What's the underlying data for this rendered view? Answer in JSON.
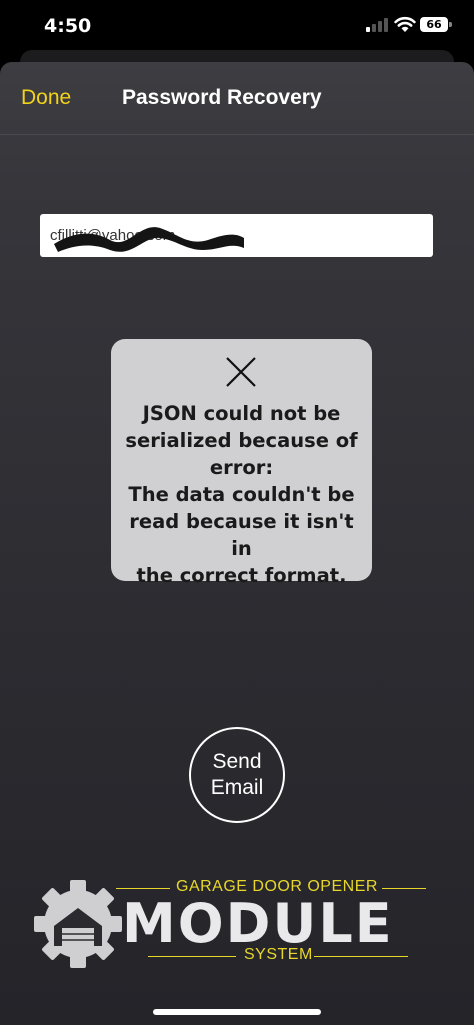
{
  "status_bar": {
    "time": "4:50",
    "battery": "66"
  },
  "nav": {
    "done_label": "Done",
    "title": "Password Recovery"
  },
  "email_field": {
    "value": "cfillitti@yahoo.com"
  },
  "error_dialog": {
    "icon": "close-icon",
    "message": "JSON could not be\nserialized because of\nerror:\nThe data couldn't be\nread because it isn't in\nthe correct format."
  },
  "send_button": {
    "label": "Send\nEmail"
  },
  "brand": {
    "top_text": "GARAGE DOOR OPENER",
    "name": "MODULE",
    "bottom_text": "SYSTEM",
    "accent_color": "#e8d72a"
  },
  "colors": {
    "done": "#f2d21a",
    "dialog_bg": "#d0d0d2"
  }
}
